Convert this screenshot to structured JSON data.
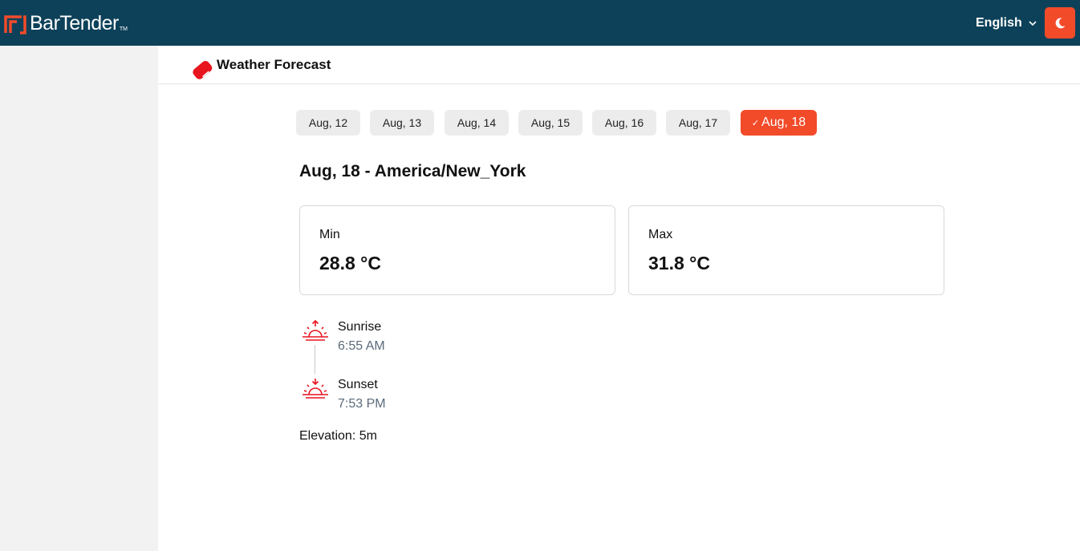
{
  "app": {
    "brand": "BarTender",
    "brand_tm": "TM",
    "accent_color": "#f24b2a",
    "header_color": "#0d4159"
  },
  "header": {
    "language": "English",
    "language_icon": "chevron-down-icon",
    "theme_icon": "moon-icon"
  },
  "page": {
    "title": "Weather Forecast",
    "icon": "tag-icon"
  },
  "dates": {
    "tabs": [
      "Aug, 12",
      "Aug, 13",
      "Aug, 14",
      "Aug, 15",
      "Aug, 16",
      "Aug, 17",
      "Aug, 18"
    ],
    "selected": "Aug, 18",
    "selected_icon": "check-icon"
  },
  "forecast": {
    "heading": "Aug, 18 - America/New_York",
    "min_label": "Min",
    "min_value": "28.8 °C",
    "max_label": "Max",
    "max_value": "31.8 °C",
    "sunrise_label": "Sunrise",
    "sunrise_time": "6:55 AM",
    "sunrise_icon": "sunrise-icon",
    "sunset_label": "Sunset",
    "sunset_time": "7:53 PM",
    "sunset_icon": "sunset-icon",
    "elevation": "Elevation: 5m"
  }
}
